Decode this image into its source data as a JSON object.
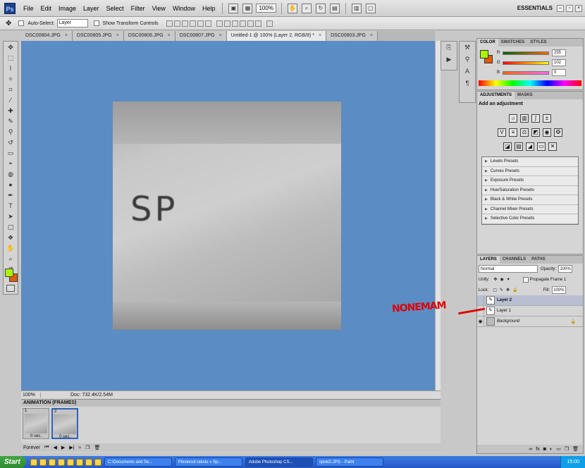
{
  "app": {
    "logo": "Ps",
    "workspace": "ESSENTIALS"
  },
  "menu": [
    "File",
    "Edit",
    "Image",
    "Layer",
    "Select",
    "Filter",
    "View",
    "Window",
    "Help"
  ],
  "zoom_select": "100%",
  "options": {
    "auto_select_label": "Auto-Select:",
    "auto_select_value": "Layer",
    "transform_label": "Show Transform Controls"
  },
  "tabs": [
    {
      "label": "DSC00804.JPG"
    },
    {
      "label": "DSC00805.JPG"
    },
    {
      "label": "DSC00806.JPG"
    },
    {
      "label": "DSC00807.JPG"
    },
    {
      "label": "Untitled-1 @ 100% (Layer 2, RGB/8) *"
    },
    {
      "label": "DSC00803.JPG"
    }
  ],
  "tab_close": "×",
  "canvas": {
    "image_text": "SP"
  },
  "status": {
    "zoom": "100%",
    "doc": "Doc: 732.4K/2.54M"
  },
  "animation": {
    "title": "ANIMATION (FRAMES)",
    "frames": [
      {
        "num": "1",
        "duration": "0 sec."
      },
      {
        "num": "2",
        "duration": "0 sec."
      }
    ],
    "loop": "Forever"
  },
  "color_panel": {
    "tabs": [
      "COLOR",
      "SWATCHES",
      "STYLES"
    ],
    "r_label": "R",
    "g_label": "G",
    "b_label": "B",
    "r": "255",
    "g": "102",
    "b": "0",
    "fg_color": "#aaf500",
    "bg_color": "#e35b00"
  },
  "adjustments": {
    "tabs": [
      "ADJUSTMENTS",
      "MASKS"
    ],
    "title": "Add an adjustment",
    "presets": [
      "Levels Presets",
      "Curves Presets",
      "Exposure Presets",
      "Hue/Saturation Presets",
      "Black & White Presets",
      "Channel Mixer Presets",
      "Selective Color Presets"
    ]
  },
  "layers_panel": {
    "tabs": [
      "LAYERS",
      "CHANNELS",
      "PATHS"
    ],
    "blend_mode": "Normal",
    "opacity_label": "Opacity:",
    "opacity": "100%",
    "unify_label": "Unify:",
    "propagate_label": "Propagate Frame 1",
    "lock_label": "Lock:",
    "fill_label": "Fill:",
    "fill": "100%",
    "layers": [
      {
        "name": "Layer 2"
      },
      {
        "name": "Layer 1"
      },
      {
        "name": "Background"
      }
    ]
  },
  "annotation": "NONEMAM",
  "taskbar": {
    "start": "Start",
    "tasks": [
      "C:\\Documents and Se...",
      "Pievienot rakstu » Sp...",
      "Adobe Photoshop CS...",
      "spoki2.JPG - Paint"
    ],
    "clock": "15:00"
  }
}
